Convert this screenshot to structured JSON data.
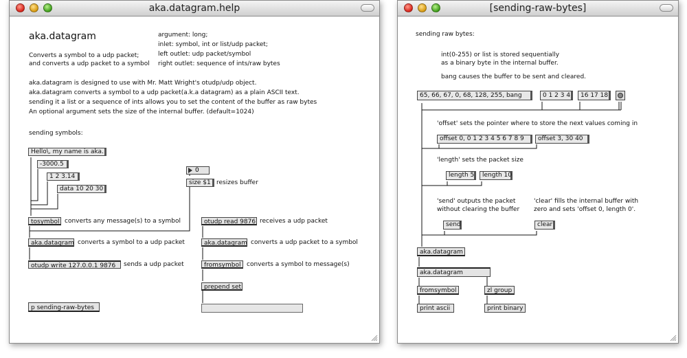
{
  "left_window": {
    "title": "aka.datagram.help",
    "heading": "aka.datagram",
    "args": [
      "argument: long;",
      "inlet: symbol, int or list/udp packet;",
      "left outlet: udp packet/symbol",
      "right outlet: sequence of ints/raw bytes"
    ],
    "desc_short": [
      "Converts a symbol to a udp packet;",
      "and converts a udp packet to a symbol"
    ],
    "desc_long": [
      "aka.datagram is designed to use with Mr. Matt Wright's otudp/udp object.",
      "aka.datagram converts a symbol to a udp packet(a.k.a datagram) as a plain ASCII text.",
      "sending it a list or a sequence of ints allows you to set the content of the buffer as raw bytes",
      "An optional argument sets the size of the internal buffer. (default=1024)"
    ],
    "section_label": "sending symbols:",
    "msg_hello": "Hello\\, my name is aka.",
    "msg_num1": "-3000.5",
    "msg_list": "1 2 3.14",
    "msg_data": "data 10 20 30",
    "num_value": "0",
    "msg_size": "size $1",
    "note_resize": "resizes buffer",
    "obj_tosymbol": "tosymbol",
    "note_tosymbol": "converts any message(s) to a symbol",
    "obj_datagram1": "aka.datagram",
    "note_datagram1": "converts a symbol to a udp packet",
    "obj_otudp_write": "otudp write 127.0.0.1 9876",
    "note_otudp_write": "sends a udp packet",
    "obj_otudp_read": "otudp read 9876",
    "note_otudp_read": "receives a udp packet",
    "obj_datagram2": "aka.datagram",
    "note_datagram2": "converts a udp packet to a symbol",
    "obj_fromsymbol": "fromsymbol",
    "note_fromsymbol": "converts a symbol to message(s)",
    "obj_prepend": "prepend set",
    "obj_subpatch": "p sending-raw-bytes"
  },
  "right_window": {
    "title": "[sending-raw-bytes]",
    "section_label": "sending raw bytes:",
    "desc": [
      "int(0-255) or list is stored sequentially",
      "as a binary byte in the internal buffer."
    ],
    "desc_bang": "bang causes the buffer to be sent and cleared.",
    "msg_bytes": "65, 66, 67, 0, 68, 128, 255, bang",
    "msg_list1": "0 1 2 3 4",
    "msg_list2": "16 17 18",
    "note_offset": "'offset' sets the pointer where to store the next values coming in",
    "msg_offset1": "offset 0, 0 1 2 3 4 5 6 7 8 9",
    "msg_offset2": "offset 3, 30 40",
    "note_length": "'length' sets the packet size",
    "msg_length5": "length 5",
    "msg_length10": "length 10",
    "note_send": [
      "'send' outputs the packet",
      "without clearing the buffer"
    ],
    "note_clear": [
      "'clear' fills the internal buffer with",
      "zero and sets 'offset 0, length 0'."
    ],
    "msg_send": "send",
    "msg_clear": "clear",
    "obj_datagram1": "aka.datagram",
    "obj_datagram2": "aka.datagram",
    "obj_fromsymbol": "fromsymbol",
    "obj_zlgroup": "zl group",
    "obj_print_ascii": "print ascii",
    "obj_print_binary": "print binary"
  }
}
